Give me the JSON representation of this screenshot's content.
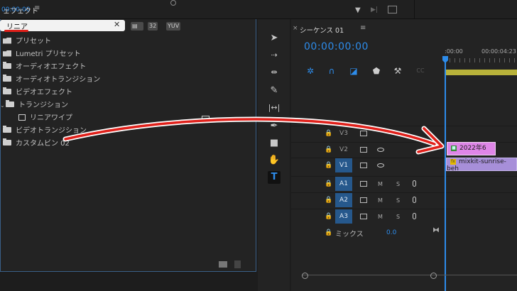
{
  "top": {
    "timecode": "00:00:00"
  },
  "effects_panel": {
    "title": "ェフェクト",
    "menu": "≡",
    "search": {
      "value": "リニア",
      "clear": "✕"
    },
    "toolbar_buttons": [
      "32",
      "YUV"
    ],
    "tree": [
      {
        "label": "プリセット",
        "icon": "preset-folder-icon",
        "indent": 0
      },
      {
        "label": "Lumetri プリセット",
        "icon": "preset-folder-icon",
        "indent": 0
      },
      {
        "label": "オーディオエフェクト",
        "icon": "folder-icon",
        "indent": 0
      },
      {
        "label": "オーディオトランジション",
        "icon": "folder-icon",
        "indent": 0
      },
      {
        "label": "ビデオエフェクト",
        "icon": "folder-icon",
        "indent": 0
      },
      {
        "label": "トランジション",
        "icon": "folder-icon",
        "indent": 1,
        "expanded": true
      },
      {
        "label": "リニアワイプ",
        "icon": "transition-icon",
        "indent": 2
      },
      {
        "label": "ビデオトランジション",
        "icon": "folder-icon",
        "indent": 0
      },
      {
        "label": "カスタムビン 02",
        "icon": "folder-icon",
        "indent": 0
      }
    ]
  },
  "tools": [
    "selection-tool-icon",
    "track-select-icon",
    "ripple-edit-icon",
    "razor-icon",
    "slip-icon",
    "pen-icon",
    "rectangle-icon",
    "hand-icon",
    "type-tool-icon"
  ],
  "sequence": {
    "close": "×",
    "tab": "シーケンス 01",
    "menu": "≡",
    "timecode": "00:00:00:00",
    "ruler": [
      ":00:00",
      "00:00:04:23"
    ],
    "video_tracks": [
      {
        "name": "V3",
        "active": false
      },
      {
        "name": "V2",
        "active": false
      },
      {
        "name": "V1",
        "active": true
      }
    ],
    "audio_tracks": [
      {
        "name": "A1",
        "m": "M",
        "s": "S"
      },
      {
        "name": "A2",
        "m": "M",
        "s": "S"
      },
      {
        "name": "A3",
        "m": "M",
        "s": "S"
      }
    ],
    "mix_label": "ミックス",
    "mix_value": "0.0",
    "clips": {
      "title_clip": "2022年6",
      "video_clip": "mixkit-sunrise-beh",
      "fx_badge": "fx"
    }
  },
  "colors": {
    "accent": "#2d8ceb",
    "track_active": "#26588c",
    "title_clip": "#df86e8",
    "video_clip": "#a78fd9",
    "arrow": "#e0201a"
  }
}
